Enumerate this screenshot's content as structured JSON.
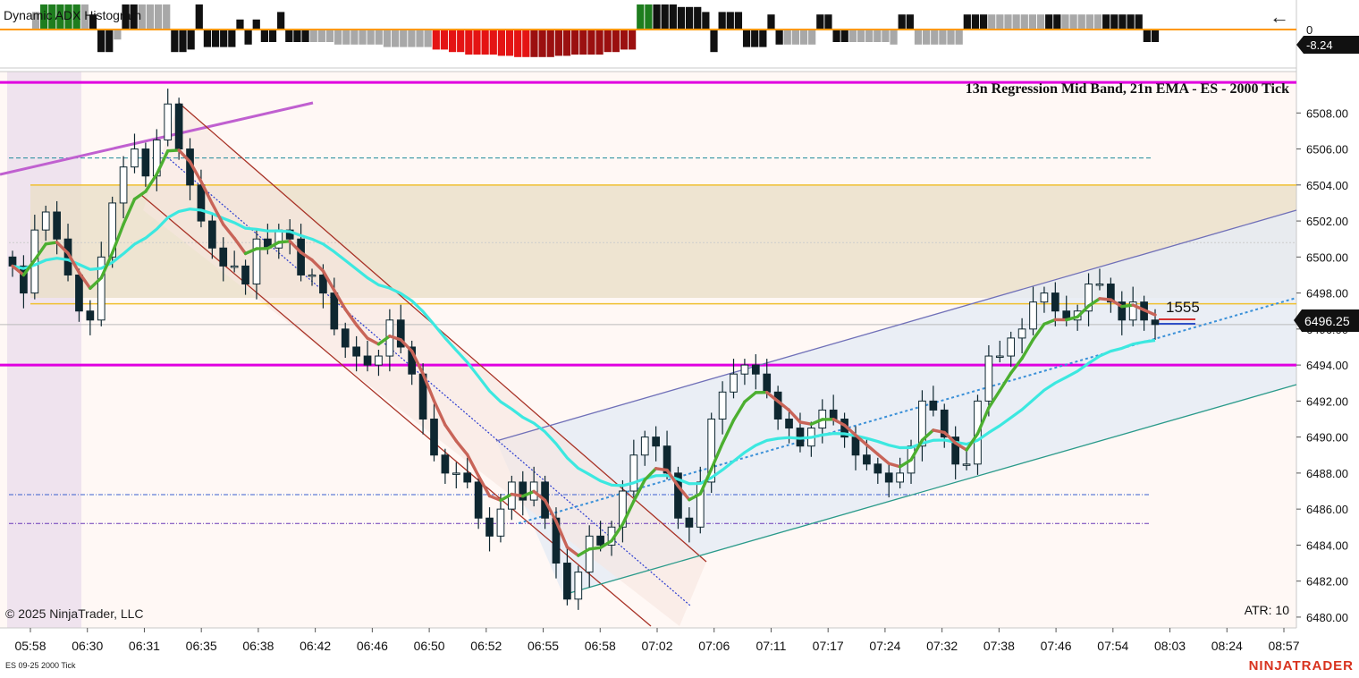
{
  "chart_data": [
    {
      "type": "bar",
      "panel": "indicator",
      "title": "Dynamic ADX Histogram",
      "yaxis_labels": [
        "0"
      ],
      "current_value_label": "-8.24",
      "zero_line_color": "#ff9800",
      "colors": {
        "green": "#1e7d1e",
        "black": "#111111",
        "gray": "#a8a8a8",
        "red": "#e41414",
        "darkred": "#9b1010"
      },
      "bars": [
        {
          "v": 0.7,
          "c": "gray"
        },
        {
          "v": 1.0,
          "c": "green"
        },
        {
          "v": 1.0,
          "c": "green"
        },
        {
          "v": 1.0,
          "c": "green"
        },
        {
          "v": 1.0,
          "c": "green"
        },
        {
          "v": 1.0,
          "c": "green"
        },
        {
          "v": 1.0,
          "c": "gray"
        },
        {
          "v": 0.6,
          "c": "black"
        },
        {
          "v": -0.9,
          "c": "black"
        },
        {
          "v": -0.9,
          "c": "black"
        },
        {
          "v": -0.4,
          "c": "gray"
        },
        {
          "v": 1.0,
          "c": "black"
        },
        {
          "v": 1.0,
          "c": "black"
        },
        {
          "v": 1.0,
          "c": "gray"
        },
        {
          "v": 1.0,
          "c": "gray"
        },
        {
          "v": 1.0,
          "c": "gray"
        },
        {
          "v": 1.0,
          "c": "gray"
        },
        {
          "v": -0.9,
          "c": "black"
        },
        {
          "v": -0.9,
          "c": "black"
        },
        {
          "v": -0.8,
          "c": "black"
        },
        {
          "v": 1.0,
          "c": "black"
        },
        {
          "v": -0.7,
          "c": "black"
        },
        {
          "v": -0.7,
          "c": "black"
        },
        {
          "v": -0.7,
          "c": "black"
        },
        {
          "v": -0.7,
          "c": "black"
        },
        {
          "v": 0.4,
          "c": "black"
        },
        {
          "v": -0.6,
          "c": "black"
        },
        {
          "v": 0.4,
          "c": "black"
        },
        {
          "v": -0.5,
          "c": "black"
        },
        {
          "v": -0.5,
          "c": "black"
        },
        {
          "v": 0.7,
          "c": "black"
        },
        {
          "v": -0.5,
          "c": "black"
        },
        {
          "v": -0.5,
          "c": "black"
        },
        {
          "v": -0.5,
          "c": "black"
        },
        {
          "v": -0.5,
          "c": "gray"
        },
        {
          "v": -0.5,
          "c": "gray"
        },
        {
          "v": -0.5,
          "c": "gray"
        },
        {
          "v": -0.6,
          "c": "gray"
        },
        {
          "v": -0.6,
          "c": "gray"
        },
        {
          "v": -0.6,
          "c": "gray"
        },
        {
          "v": -0.6,
          "c": "gray"
        },
        {
          "v": -0.6,
          "c": "gray"
        },
        {
          "v": -0.6,
          "c": "gray"
        },
        {
          "v": -0.7,
          "c": "gray"
        },
        {
          "v": -0.7,
          "c": "gray"
        },
        {
          "v": -0.7,
          "c": "gray"
        },
        {
          "v": -0.7,
          "c": "gray"
        },
        {
          "v": -0.7,
          "c": "gray"
        },
        {
          "v": -0.7,
          "c": "gray"
        },
        {
          "v": -0.8,
          "c": "red"
        },
        {
          "v": -0.8,
          "c": "red"
        },
        {
          "v": -0.9,
          "c": "red"
        },
        {
          "v": -0.9,
          "c": "red"
        },
        {
          "v": -1.0,
          "c": "red"
        },
        {
          "v": -1.0,
          "c": "red"
        },
        {
          "v": -1.0,
          "c": "red"
        },
        {
          "v": -1.0,
          "c": "red"
        },
        {
          "v": -1.05,
          "c": "red"
        },
        {
          "v": -1.05,
          "c": "red"
        },
        {
          "v": -1.1,
          "c": "red"
        },
        {
          "v": -1.1,
          "c": "red"
        },
        {
          "v": -1.1,
          "c": "darkred"
        },
        {
          "v": -1.1,
          "c": "darkred"
        },
        {
          "v": -1.1,
          "c": "darkred"
        },
        {
          "v": -1.05,
          "c": "darkred"
        },
        {
          "v": -1.05,
          "c": "darkred"
        },
        {
          "v": -1.0,
          "c": "darkred"
        },
        {
          "v": -1.0,
          "c": "darkred"
        },
        {
          "v": -1.0,
          "c": "darkred"
        },
        {
          "v": -1.0,
          "c": "darkred"
        },
        {
          "v": -0.9,
          "c": "darkred"
        },
        {
          "v": -0.9,
          "c": "darkred"
        },
        {
          "v": -0.8,
          "c": "darkred"
        },
        {
          "v": -0.8,
          "c": "darkred"
        },
        {
          "v": 1.0,
          "c": "green"
        },
        {
          "v": 1.0,
          "c": "green"
        },
        {
          "v": 1.0,
          "c": "black"
        },
        {
          "v": 1.0,
          "c": "black"
        },
        {
          "v": 1.0,
          "c": "black"
        },
        {
          "v": 0.9,
          "c": "black"
        },
        {
          "v": 0.9,
          "c": "black"
        },
        {
          "v": 0.9,
          "c": "black"
        },
        {
          "v": 0.7,
          "c": "black"
        },
        {
          "v": -0.9,
          "c": "black"
        },
        {
          "v": 0.7,
          "c": "black"
        },
        {
          "v": 0.7,
          "c": "black"
        },
        {
          "v": 0.7,
          "c": "black"
        },
        {
          "v": -0.7,
          "c": "black"
        },
        {
          "v": -0.7,
          "c": "black"
        },
        {
          "v": -0.7,
          "c": "black"
        },
        {
          "v": 0.6,
          "c": "black"
        },
        {
          "v": -0.6,
          "c": "black"
        },
        {
          "v": -0.6,
          "c": "gray"
        },
        {
          "v": -0.6,
          "c": "gray"
        },
        {
          "v": -0.6,
          "c": "gray"
        },
        {
          "v": -0.6,
          "c": "gray"
        },
        {
          "v": 0.6,
          "c": "black"
        },
        {
          "v": 0.6,
          "c": "black"
        },
        {
          "v": -0.5,
          "c": "black"
        },
        {
          "v": -0.5,
          "c": "black"
        },
        {
          "v": -0.5,
          "c": "gray"
        },
        {
          "v": -0.5,
          "c": "gray"
        },
        {
          "v": -0.5,
          "c": "gray"
        },
        {
          "v": -0.5,
          "c": "gray"
        },
        {
          "v": -0.5,
          "c": "gray"
        },
        {
          "v": -0.6,
          "c": "gray"
        },
        {
          "v": 0.6,
          "c": "black"
        },
        {
          "v": 0.6,
          "c": "black"
        },
        {
          "v": -0.6,
          "c": "gray"
        },
        {
          "v": -0.6,
          "c": "gray"
        },
        {
          "v": -0.6,
          "c": "gray"
        },
        {
          "v": -0.6,
          "c": "gray"
        },
        {
          "v": -0.6,
          "c": "gray"
        },
        {
          "v": -0.6,
          "c": "gray"
        },
        {
          "v": 0.6,
          "c": "black"
        },
        {
          "v": 0.6,
          "c": "black"
        },
        {
          "v": 0.6,
          "c": "black"
        },
        {
          "v": 0.6,
          "c": "gray"
        },
        {
          "v": 0.6,
          "c": "gray"
        },
        {
          "v": 0.6,
          "c": "gray"
        },
        {
          "v": 0.6,
          "c": "gray"
        },
        {
          "v": 0.6,
          "c": "gray"
        },
        {
          "v": 0.6,
          "c": "gray"
        },
        {
          "v": 0.6,
          "c": "gray"
        },
        {
          "v": 0.6,
          "c": "black"
        },
        {
          "v": 0.6,
          "c": "black"
        },
        {
          "v": 0.6,
          "c": "gray"
        },
        {
          "v": 0.6,
          "c": "gray"
        },
        {
          "v": 0.6,
          "c": "gray"
        },
        {
          "v": 0.6,
          "c": "gray"
        },
        {
          "v": 0.6,
          "c": "gray"
        },
        {
          "v": 0.6,
          "c": "black"
        },
        {
          "v": 0.6,
          "c": "black"
        },
        {
          "v": 0.6,
          "c": "black"
        },
        {
          "v": 0.6,
          "c": "black"
        },
        {
          "v": 0.6,
          "c": "black"
        },
        {
          "v": -0.5,
          "c": "black"
        },
        {
          "v": -0.5,
          "c": "black"
        }
      ]
    },
    {
      "type": "candlestick",
      "panel": "price",
      "title": "13n Regression Mid Band, 21n EMA - ES - 2000 Tick",
      "instrument": "ES 09-25 2000 Tick",
      "ylim": [
        6479.4,
        6510.3
      ],
      "yticks": [
        6480,
        6482,
        6484,
        6486,
        6488,
        6490,
        6492,
        6494,
        6496,
        6498,
        6500,
        6502,
        6504,
        6506,
        6508
      ],
      "ytick_labels": [
        "6480.00",
        "6482.00",
        "6484.00",
        "6486.00",
        "6488.00",
        "6490.00",
        "6492.00",
        "6494.00",
        "6496.00",
        "6498.00",
        "6500.00",
        "6502.00",
        "6504.00",
        "6506.00",
        "6508.00"
      ],
      "xtick_labels": [
        "05:58",
        "06:30",
        "06:31",
        "06:35",
        "06:38",
        "06:42",
        "06:46",
        "06:50",
        "06:52",
        "06:55",
        "06:58",
        "07:02",
        "07:06",
        "07:11",
        "07:17",
        "07:24",
        "07:32",
        "07:38",
        "07:46",
        "07:54",
        "08:03",
        "08:24",
        "08:57"
      ],
      "last_price_label": "6496.25",
      "last_price": 6496.25,
      "volume_label": "1555",
      "atr_label": "ATR: 10",
      "copyright": "© 2025 NinjaTrader, LLC",
      "brand": "NINJATRADER",
      "closes": [
        6499.5,
        6498,
        6501.5,
        6502.5,
        6501,
        6499,
        6497,
        6496.5,
        6500,
        6503,
        6505,
        6506,
        6504.5,
        6506.5,
        6508.5,
        6506,
        6504,
        6502,
        6500.5,
        6499.5,
        6499.5,
        6498.5,
        6501,
        6500.5,
        6501.5,
        6501,
        6499,
        6499,
        6498,
        6496,
        6495,
        6494.5,
        6494,
        6494.5,
        6496.5,
        6495,
        6493.5,
        6491,
        6489,
        6488,
        6488,
        6487.5,
        6485.5,
        6484.5,
        6486,
        6487.5,
        6486.5,
        6487.5,
        6485.5,
        6483,
        6481,
        6482.5,
        6484.5,
        6484,
        6485,
        6487,
        6489,
        6490,
        6489.5,
        6488,
        6485.5,
        6485,
        6487.5,
        6491,
        6492.5,
        6493.5,
        6494,
        6493.5,
        6492.5,
        6491,
        6490.5,
        6489.5,
        6490.5,
        6491.5,
        6491,
        6490,
        6489,
        6488.5,
        6488,
        6487.5,
        6488,
        6489.5,
        6492,
        6491.5,
        6490,
        6488.5,
        6488.5,
        6492,
        6494.5,
        6494.5,
        6495.5,
        6496,
        6497.5,
        6498,
        6497,
        6496.5,
        6497,
        6498.5,
        6498.5,
        6497.5,
        6496.5,
        6497.5,
        6496.5,
        6496.25
      ],
      "colors": {
        "up": "#ffffff",
        "down": "#0e2730",
        "wick": "#0e2730"
      },
      "series": [
        {
          "name": "21n EMA",
          "color": "#3ce8e0"
        },
        {
          "name": "13n Regression Mid Band",
          "up_color": "#4caf30",
          "down_color": "#c86458"
        }
      ],
      "levels": [
        {
          "price": 6509.7,
          "color": "#e000e0",
          "style": "solid"
        },
        {
          "price": 6494,
          "color": "#e000e0",
          "style": "solid"
        },
        {
          "price": 6505.5,
          "color": "#1e8a9a",
          "style": "dashed"
        },
        {
          "price": 6504,
          "color": "#f0c030",
          "style": "solid"
        },
        {
          "price": 6497.4,
          "color": "#f0c030",
          "style": "solid"
        },
        {
          "price": 6500.8,
          "color": "#cccccc",
          "style": "dotted"
        },
        {
          "price": 6486.8,
          "color": "#3a5fcf",
          "style": "dashdot"
        },
        {
          "price": 6485.2,
          "color": "#6a3ab8",
          "style": "dashdot"
        }
      ]
    }
  ]
}
